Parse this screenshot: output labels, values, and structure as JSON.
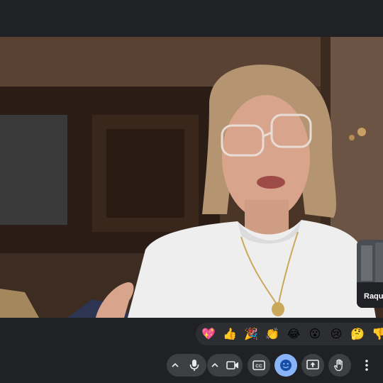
{
  "meeting": {
    "main_participant": "speaker",
    "self_view": {
      "name": "Raque"
    }
  },
  "reactions": [
    {
      "name": "sparkling-heart",
      "emoji": "💖"
    },
    {
      "name": "thumbs-up",
      "emoji": "👍"
    },
    {
      "name": "party-popper",
      "emoji": "🎉"
    },
    {
      "name": "clapping-hands",
      "emoji": "👏"
    },
    {
      "name": "tears-of-joy",
      "emoji": "😂"
    },
    {
      "name": "surprised",
      "emoji": "😮"
    },
    {
      "name": "sad",
      "emoji": "😢"
    },
    {
      "name": "thinking",
      "emoji": "🤔"
    },
    {
      "name": "thumbs-down",
      "emoji": "👎"
    }
  ],
  "controls": {
    "mic_options": "chevron-up-icon",
    "mic": "microphone-icon",
    "camera_options": "chevron-up-icon",
    "camera": "video-camera-icon",
    "captions": "closed-captions-icon",
    "reactions": "emoji-icon",
    "present": "present-screen-icon",
    "raise_hand": "hand-icon",
    "more": "more-vert-icon"
  },
  "colors": {
    "background": "#202124",
    "button": "#3c4043",
    "active_button": "#8ab4f8",
    "icon": "#e8eaed"
  }
}
